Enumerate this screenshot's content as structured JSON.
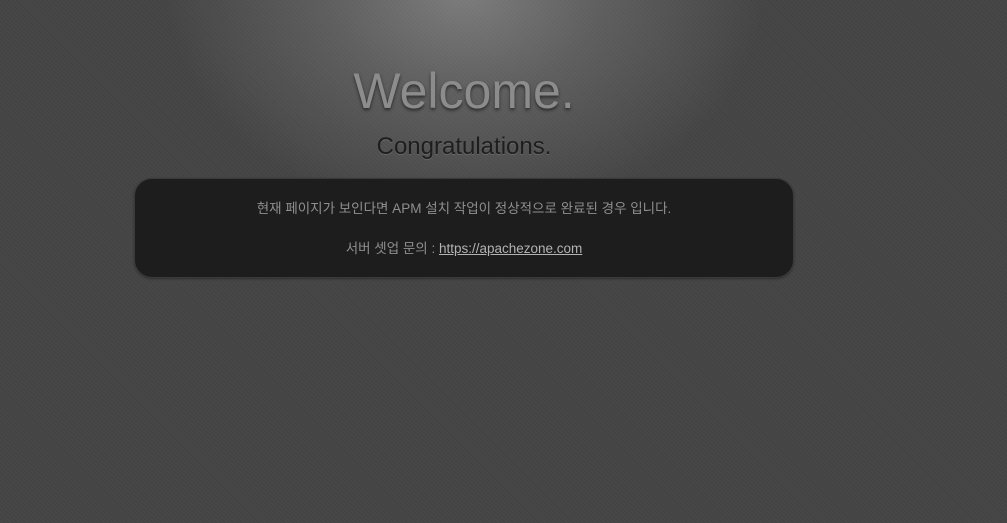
{
  "heading": {
    "title": "Welcome.",
    "subtitle": "Congratulations."
  },
  "panel": {
    "message": "현재 페이지가 보인다면 APM 설치 작업이 정상적으로 완료된 경우 입니다.",
    "contact_label": "서버 셋업 문의 : ",
    "contact_link": "https://apachezone.com"
  },
  "colors": {
    "background": "#444444",
    "panel_background": "#1d1d1d",
    "title_text": "#8c8c8c",
    "subtitle_text": "#1e1e1e",
    "panel_text": "#8f8f8f",
    "link_text": "#b3b3b3"
  }
}
